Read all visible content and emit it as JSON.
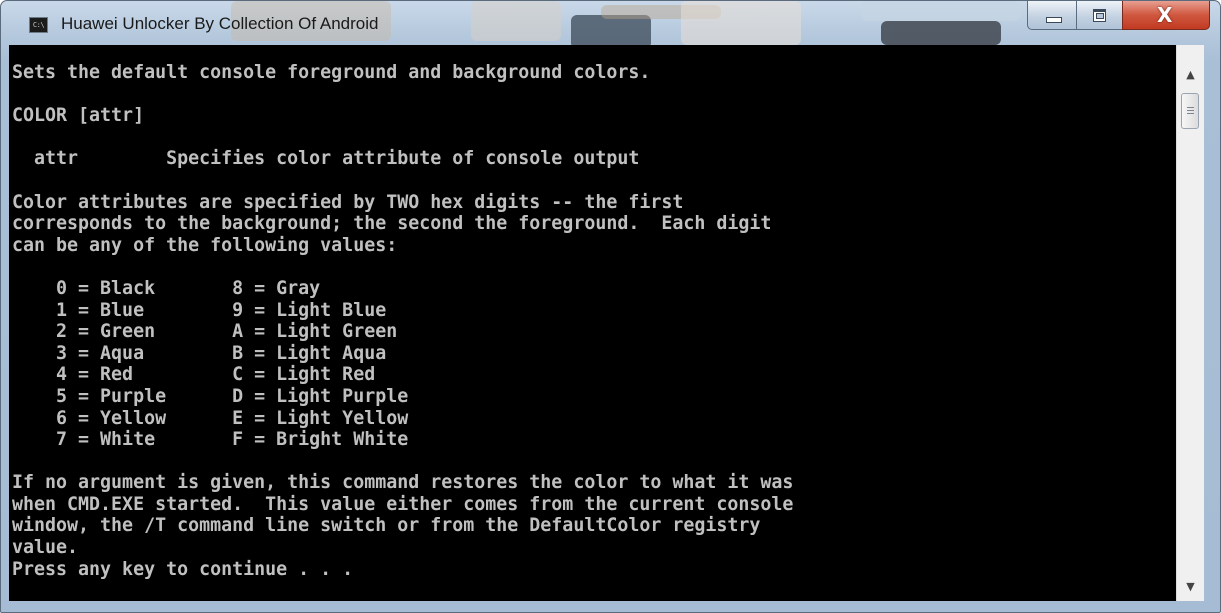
{
  "window": {
    "title": "Huawei Unlocker By Collection Of Android",
    "icon_text": "C:\\",
    "icon_name": "cmd-icon"
  },
  "controls": {
    "minimize": "minimize-icon",
    "maximize": "maximize-icon",
    "close": "close-icon",
    "close_glyph": "X"
  },
  "console": {
    "foreground": "#c0c0c0",
    "background": "#000000",
    "lines": [
      "Sets the default console foreground and background colors.",
      "",
      "COLOR [attr]",
      "",
      "  attr        Specifies color attribute of console output",
      "",
      "Color attributes are specified by TWO hex digits -- the first",
      "corresponds to the background; the second the foreground.  Each digit",
      "can be any of the following values:",
      "",
      "    0 = Black       8 = Gray",
      "    1 = Blue        9 = Light Blue",
      "    2 = Green       A = Light Green",
      "    3 = Aqua        B = Light Aqua",
      "    4 = Red         C = Light Red",
      "    5 = Purple      D = Light Purple",
      "    6 = Yellow      E = Light Yellow",
      "    7 = White       F = Bright White",
      "",
      "If no argument is given, this command restores the color to what it was",
      "when CMD.EXE started.  This value either comes from the current console",
      "window, the /T command line switch or from the DefaultColor registry",
      "value.",
      "Press any key to continue . . ."
    ]
  },
  "scrollbar": {
    "up_arrow": "▲",
    "down_arrow": "▼"
  }
}
